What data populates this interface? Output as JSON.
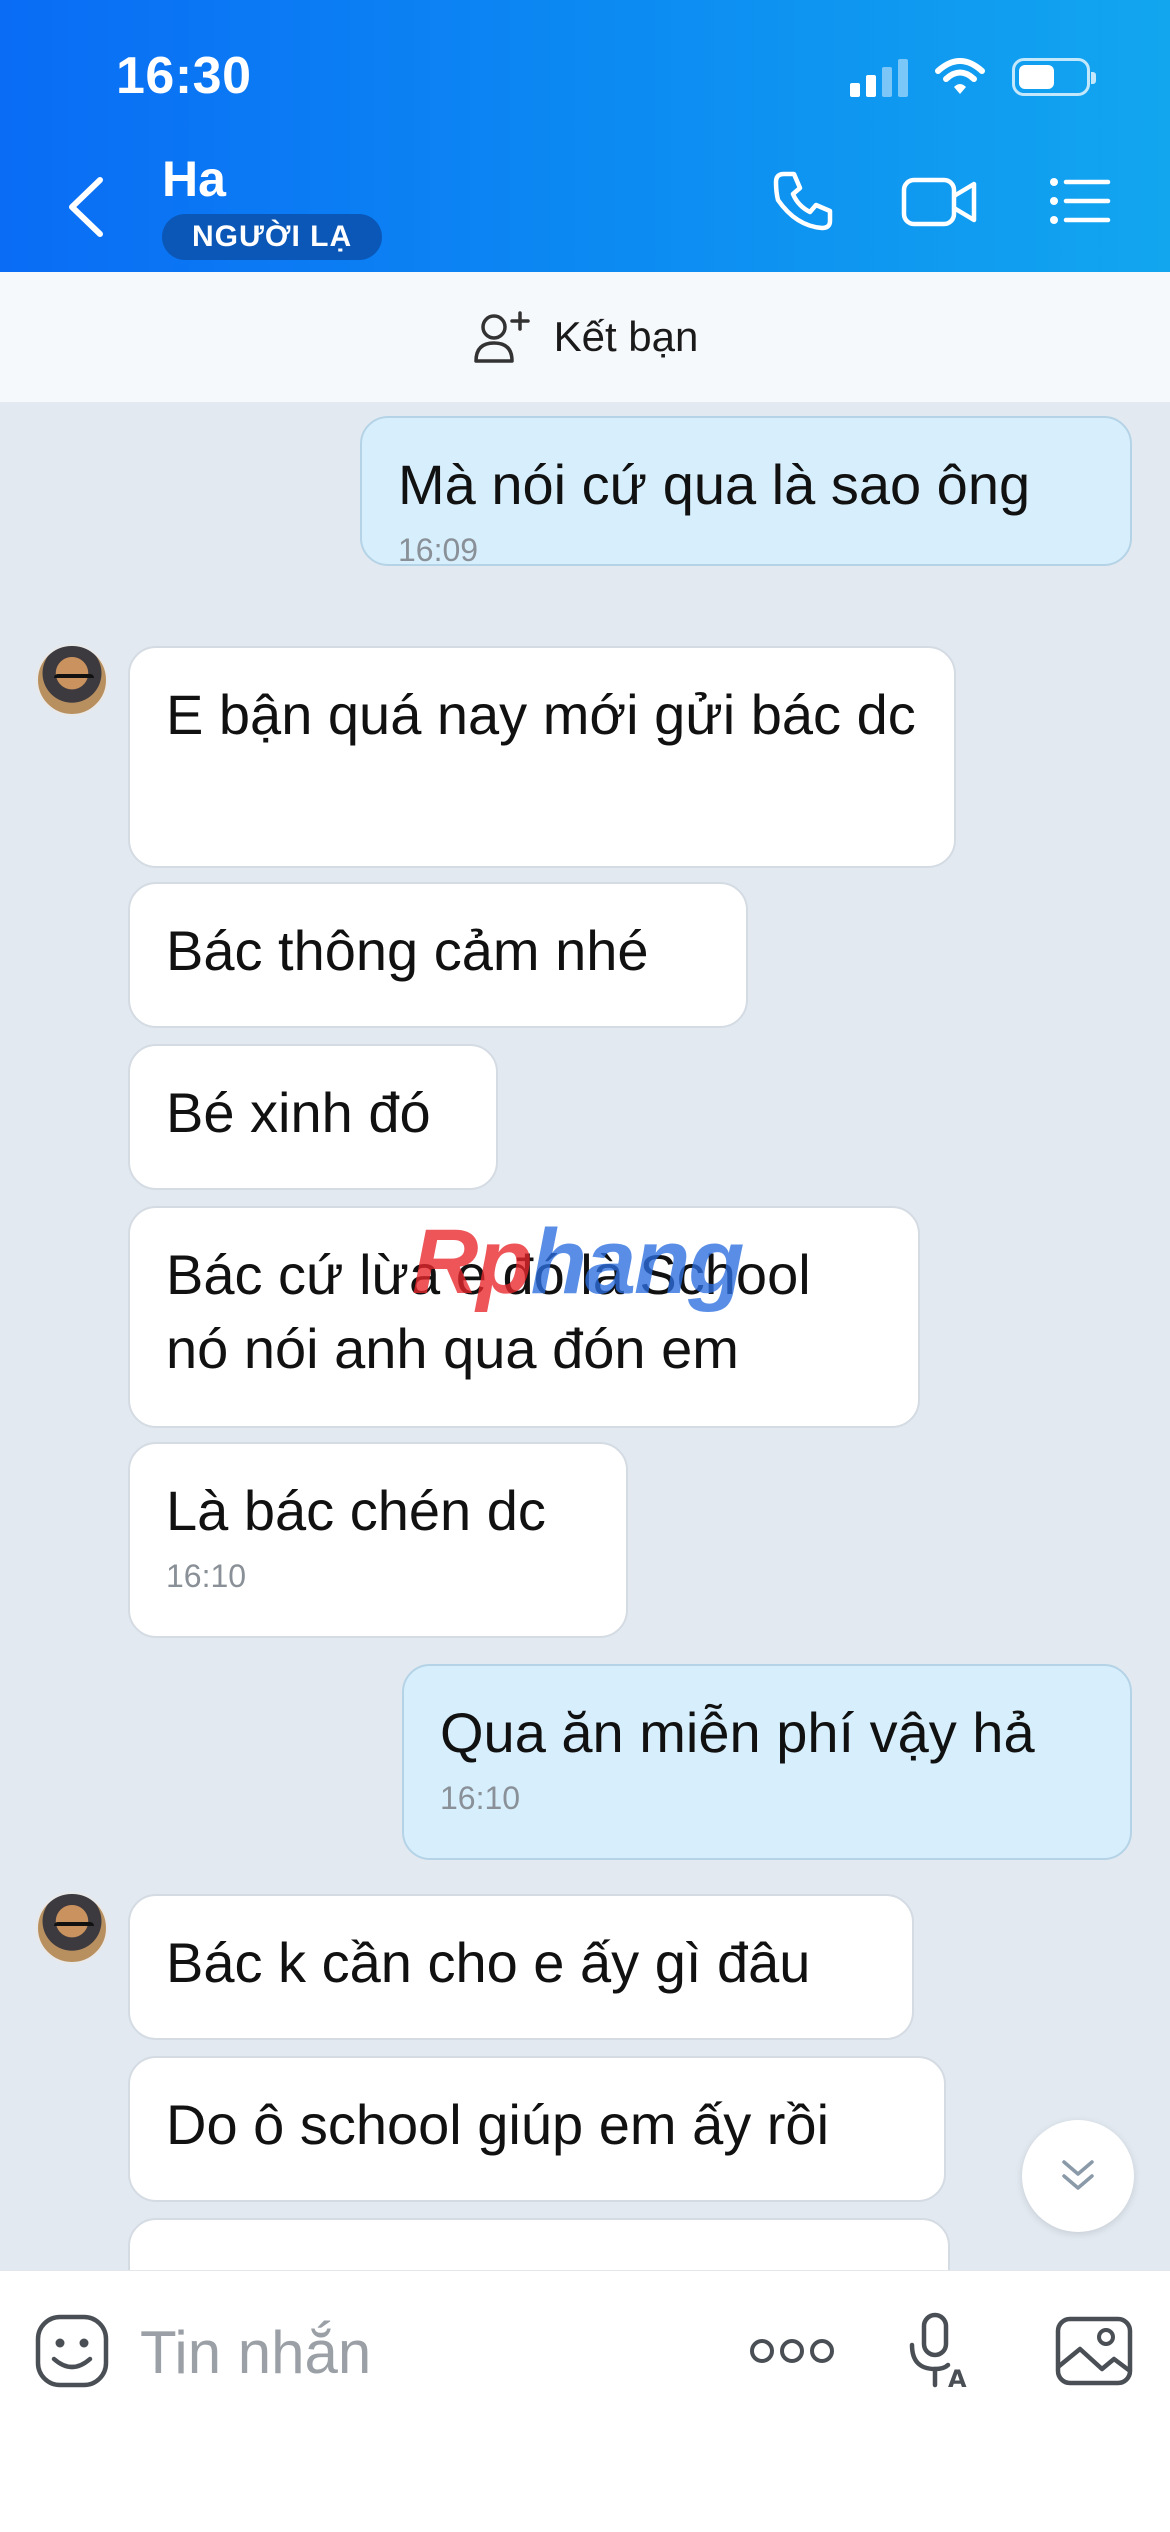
{
  "status_bar": {
    "time": "16:30"
  },
  "header": {
    "contact_name": "Ha",
    "badge": "NGƯỜI LẠ",
    "icons": [
      "back-icon",
      "phone-icon",
      "video-camera-icon",
      "list-menu-icon"
    ]
  },
  "add_friend": {
    "label": "Kết bạn",
    "icon": "add-person-icon"
  },
  "messages": [
    {
      "dir": "out",
      "text": "Mà nói cứ qua là sao ông",
      "time": "16:09"
    },
    {
      "dir": "in",
      "text": "E bận quá nay mới gửi bác dc",
      "avatar": true
    },
    {
      "dir": "in",
      "text": "Bác thông cảm nhé"
    },
    {
      "dir": "in",
      "text": "Bé xinh đó"
    },
    {
      "dir": "in",
      "text": "Bác cứ lừa e đó là School nó nói anh qua đón em"
    },
    {
      "dir": "in",
      "text": "Là bác chén dc",
      "time": "16:10"
    },
    {
      "dir": "out",
      "text": "Qua ăn miễn phí vậy hả",
      "time": "16:10"
    },
    {
      "dir": "in",
      "text": "Bác k cần cho e ấy gì đâu",
      "avatar": true
    },
    {
      "dir": "in",
      "text": "Do ô school giúp em ấy rồi"
    }
  ],
  "watermark": {
    "part1": "Rp",
    "part2": "hang"
  },
  "composer": {
    "placeholder": "Tin nhắn"
  },
  "colors": {
    "header_gradient_start": "#0a6cf5",
    "header_gradient_end": "#12a6ef",
    "chat_background": "#e2e9f1",
    "outgoing_bubble": "#d7effd",
    "incoming_bubble": "#ffffff"
  }
}
